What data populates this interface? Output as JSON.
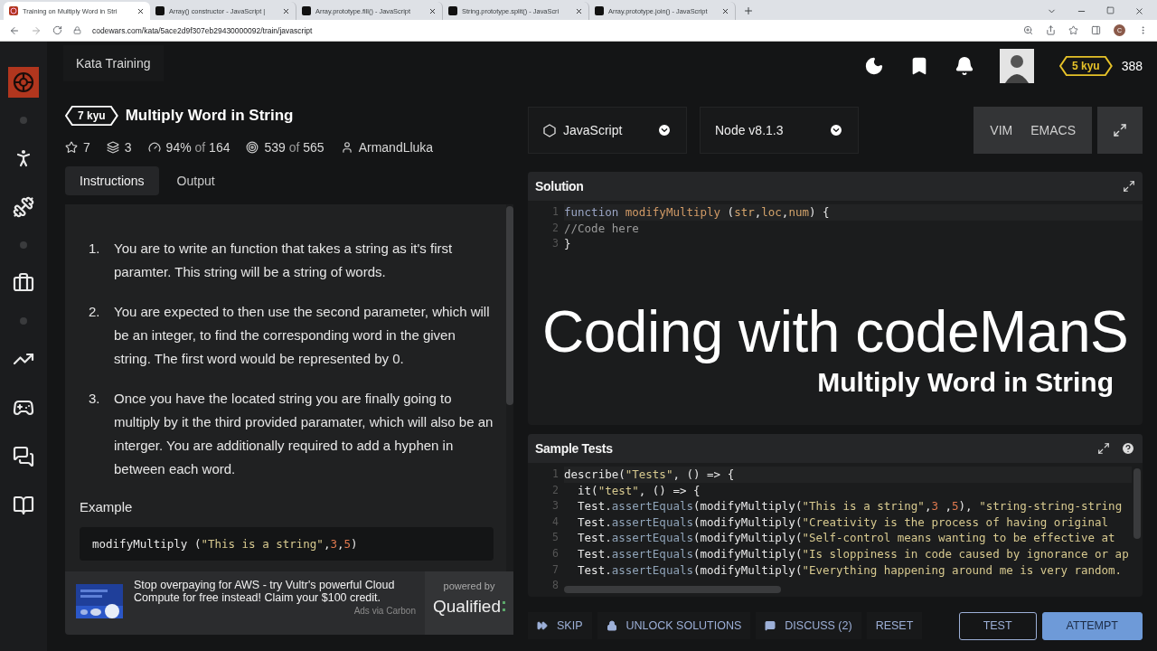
{
  "browser": {
    "tabs": [
      {
        "title": "Training on Multiply Word in Stri",
        "kind": "codewars",
        "selected": true
      },
      {
        "title": "Array() constructor - JavaScript |",
        "kind": "mdn",
        "selected": false
      },
      {
        "title": "Array.prototype.fill() - JavaScript",
        "kind": "mdn",
        "selected": false
      },
      {
        "title": "String.prototype.split() - JavaScri",
        "kind": "mdn",
        "selected": false
      },
      {
        "title": "Array.prototype.join() - JavaScript",
        "kind": "mdn",
        "selected": false
      }
    ],
    "url": "codewars.com/kata/5ace2d9f307eb29430000092/train/javascript",
    "profile": "C"
  },
  "sidebar": {
    "items": [
      {
        "kind": "logo"
      },
      {
        "kind": "dot"
      },
      {
        "kind": "training"
      },
      {
        "kind": "gym"
      },
      {
        "kind": "dot"
      },
      {
        "kind": "jobs"
      },
      {
        "kind": "dot"
      },
      {
        "kind": "leaders"
      },
      {
        "kind": "discord"
      },
      {
        "kind": "chat"
      },
      {
        "kind": "docs"
      }
    ]
  },
  "topbar": {
    "nav": "Kata Training",
    "rank": "5 kyu",
    "honor": "388"
  },
  "kata": {
    "rank": "7 kyu",
    "title": "Multiply Word in String",
    "stats": [
      {
        "kind": "stars",
        "value": "7"
      },
      {
        "kind": "collections",
        "value": "3"
      },
      {
        "kind": "satisfaction",
        "value": "94%",
        "joiner": "of",
        "total": "164"
      },
      {
        "kind": "completed",
        "value": "539",
        "joiner": "of",
        "total": "565"
      },
      {
        "kind": "author",
        "value": "ArmandLluka"
      }
    ],
    "tabs": [
      {
        "label": "Instructions",
        "selected": true
      },
      {
        "label": "Output",
        "selected": false
      }
    ],
    "instructions": [
      {
        "number": "1.",
        "text": "You are to write an function that takes a string as it's first paramter. This string will be a string of words."
      },
      {
        "number": "2.",
        "text": "You are expected to then use the second parameter, which will be an integer, to find the corresponding word in the given string. The first word would be represented by 0."
      },
      {
        "number": "3.",
        "text": "Once you have the located string you are finally going to multiply by it the third provided paramater, which will also be an interger. You are additionally required to add a hyphen in between each word."
      }
    ],
    "example_heading": "Example",
    "example_code": [
      {
        "kind": "plain",
        "text": "modifyMultiply ("
      },
      {
        "kind": "string",
        "text": "\"This is a string\""
      },
      {
        "kind": "plain",
        "text": ","
      },
      {
        "kind": "number",
        "text": "3"
      },
      {
        "kind": "plain",
        "text": ","
      },
      {
        "kind": "number",
        "text": "5"
      },
      {
        "kind": "plain",
        "text": ")"
      }
    ]
  },
  "ad": {
    "text": "Stop overpaying for AWS - try Vultr's powerful Cloud Compute for free instead! Claim your $100 credit.",
    "via": "Ads via Carbon",
    "powered_by": "powered by",
    "brand": "Qualified"
  },
  "editor": {
    "language": "JavaScript",
    "version": "Node v8.1.3",
    "modes": [
      {
        "label": "VIM",
        "selected": false
      },
      {
        "label": "EMACS",
        "selected": false
      }
    ],
    "solution": {
      "title": "Solution",
      "lines": [
        {
          "number": "1",
          "tokens": [
            {
              "kind": "keyword",
              "text": "function "
            },
            {
              "kind": "fn",
              "text": "modifyMultiply"
            },
            {
              "kind": "plain",
              "text": " ("
            },
            {
              "kind": "param",
              "text": "str"
            },
            {
              "kind": "plain",
              "text": ","
            },
            {
              "kind": "param",
              "text": "loc"
            },
            {
              "kind": "plain",
              "text": ","
            },
            {
              "kind": "param",
              "text": "num"
            },
            {
              "kind": "plain",
              "text": ") {"
            }
          ]
        },
        {
          "number": "2",
          "tokens": [
            {
              "kind": "comment",
              "text": "//Code here"
            }
          ]
        },
        {
          "number": "3",
          "tokens": [
            {
              "kind": "plain",
              "text": "}"
            }
          ]
        }
      ]
    },
    "tests": {
      "title": "Sample Tests",
      "lines": [
        {
          "number": "1",
          "tokens": [
            {
              "kind": "plain",
              "text": "describe("
            },
            {
              "kind": "string",
              "text": "\"Tests\""
            },
            {
              "kind": "plain",
              "text": ", () => {"
            }
          ]
        },
        {
          "number": "2",
          "tokens": [
            {
              "kind": "plain",
              "text": "  it("
            },
            {
              "kind": "string",
              "text": "\"test\""
            },
            {
              "kind": "plain",
              "text": ", () => {"
            }
          ]
        },
        {
          "number": "3",
          "tokens": [
            {
              "kind": "plain",
              "text": "  Test."
            },
            {
              "kind": "method",
              "text": "assertEquals"
            },
            {
              "kind": "plain",
              "text": "(modifyMultiply("
            },
            {
              "kind": "string",
              "text": "\"This is a string\""
            },
            {
              "kind": "plain",
              "text": ","
            },
            {
              "kind": "number",
              "text": "3"
            },
            {
              "kind": "plain",
              "text": " ,"
            },
            {
              "kind": "number",
              "text": "5"
            },
            {
              "kind": "plain",
              "text": "), "
            },
            {
              "kind": "string",
              "text": "\"string-string-string"
            }
          ]
        },
        {
          "number": "4",
          "tokens": [
            {
              "kind": "plain",
              "text": "  Test."
            },
            {
              "kind": "method",
              "text": "assertEquals"
            },
            {
              "kind": "plain",
              "text": "(modifyMultiply("
            },
            {
              "kind": "string",
              "text": "\"Creativity is the process of having original"
            }
          ]
        },
        {
          "number": "5",
          "tokens": [
            {
              "kind": "plain",
              "text": "  Test."
            },
            {
              "kind": "method",
              "text": "assertEquals"
            },
            {
              "kind": "plain",
              "text": "(modifyMultiply("
            },
            {
              "kind": "string",
              "text": "\"Self-control means wanting to be effective at"
            }
          ]
        },
        {
          "number": "6",
          "tokens": [
            {
              "kind": "plain",
              "text": "  Test."
            },
            {
              "kind": "method",
              "text": "assertEquals"
            },
            {
              "kind": "plain",
              "text": "(modifyMultiply("
            },
            {
              "kind": "string",
              "text": "\"Is sloppiness in code caused by ignorance or ap"
            }
          ]
        },
        {
          "number": "7",
          "tokens": [
            {
              "kind": "plain",
              "text": "  Test."
            },
            {
              "kind": "method",
              "text": "assertEquals"
            },
            {
              "kind": "plain",
              "text": "(modifyMultiply("
            },
            {
              "kind": "string",
              "text": "\"Everything happening around me is very random."
            }
          ]
        },
        {
          "number": "8"
        }
      ]
    }
  },
  "overlay": {
    "title": "Coding with codeManS",
    "subtitle": "Multiply Word in String"
  },
  "actions": [
    {
      "kind": "skip",
      "label": "SKIP"
    },
    {
      "kind": "unlock",
      "label": "UNLOCK SOLUTIONS"
    },
    {
      "kind": "discuss",
      "label": "DISCUSS (2)"
    },
    {
      "kind": "reset",
      "label": "RESET"
    }
  ],
  "submit": [
    {
      "kind": "outline",
      "label": "TEST"
    },
    {
      "kind": "primary",
      "label": "ATTEMPT"
    }
  ]
}
